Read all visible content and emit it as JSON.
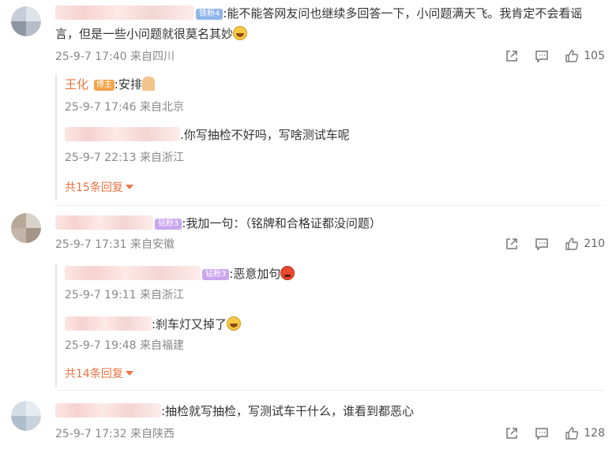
{
  "comments": [
    {
      "badge": "铁粉4",
      "text": ":能不能答网友问也继续多回答一下，小问题满天飞。我肯定不会看谣",
      "text2": "言，但是一些小问题就很莫名其妙",
      "date": "25-9-7 17:40",
      "location": "来自四川",
      "likes": "105",
      "replies": [
        {
          "name": "王化",
          "badge": "博主",
          "text": ":安排",
          "date": "25-9-7 17:46",
          "location": "来自北京"
        },
        {
          "text": ".你写抽检不好吗，写啥测试车呢",
          "date": "25-9-7 22:13",
          "location": "来自浙江"
        }
      ],
      "more": "共15条回复"
    },
    {
      "badge": "钻粉3",
      "text": ":我加一句：（铭牌和合格证都没问题）",
      "date": "25-9-7 17:31",
      "location": "来自安徽",
      "likes": "210",
      "replies": [
        {
          "badge": "钻粉3",
          "text": ":恶意加句",
          "date": "25-9-7 19:11",
          "location": "来自浙江"
        },
        {
          "text": ":刹车灯又掉了",
          "date": "25-9-7 19:48",
          "location": "来自福建"
        }
      ],
      "more": "共14条回复"
    },
    {
      "text": ":抽检就写抽检，写测试车干什么，谁看到都恶心",
      "date": "25-9-7 17:32",
      "location": "来自陕西",
      "likes": "128"
    }
  ],
  "icons": {
    "share": "share-icon",
    "comment": "comment-icon",
    "like": "thumbs-up-icon"
  },
  "colors": {
    "accent": "#eb7340",
    "meta": "#888888",
    "text": "#333333"
  }
}
